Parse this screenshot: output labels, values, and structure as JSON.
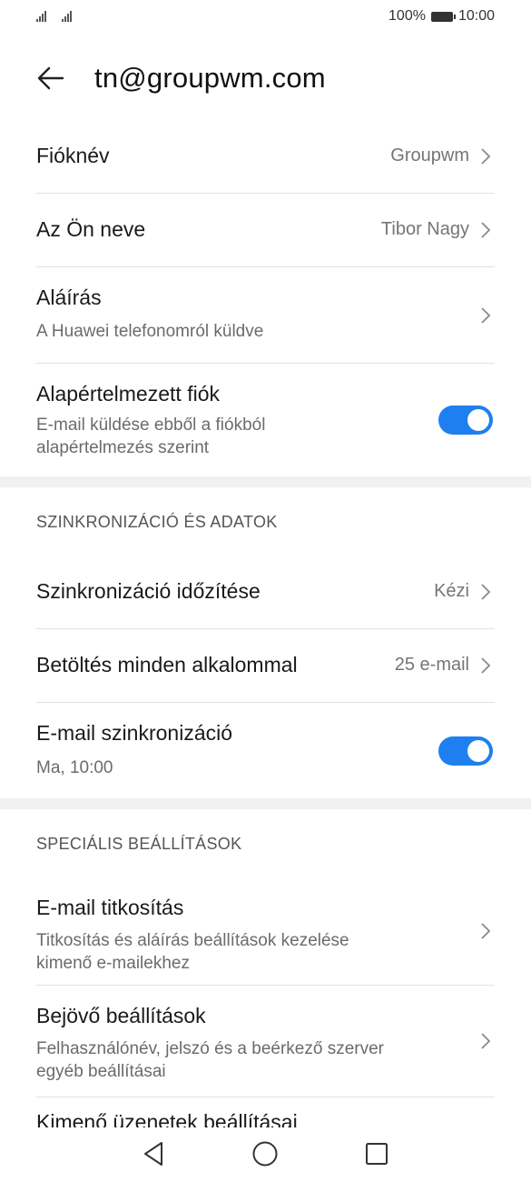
{
  "status_bar": {
    "battery_percent": "100%",
    "time": "10:00"
  },
  "header": {
    "title": "tn@groupwm.com",
    "back_icon": "arrow-left-icon"
  },
  "account": {
    "account_name": {
      "label": "Fióknév",
      "value": "Groupwm"
    },
    "your_name": {
      "label": "Az Ön neve",
      "value": "Tibor Nagy"
    },
    "signature": {
      "label": "Aláírás",
      "subtitle": "A Huawei telefonomról küldve"
    },
    "default_account": {
      "label": "Alapértelmezett fiók",
      "subtitle_line1": "E-mail küldése ebből a fiókból",
      "subtitle_line2": "alapértelmezés szerint",
      "enabled": true
    }
  },
  "sync_section": {
    "header": "SZINKRONIZÁCIÓ ÉS ADATOK",
    "schedule": {
      "label": "Szinkronizáció időzítése",
      "value": "Kézi"
    },
    "load_each_time": {
      "label": "Betöltés minden alkalommal",
      "value": "25 e-mail"
    },
    "email_sync": {
      "label": "E-mail szinkronizáció",
      "subtitle": "Ma, 10:00",
      "enabled": true
    }
  },
  "advanced_section": {
    "header": "SPECIÁLIS BEÁLLÍTÁSOK",
    "encryption": {
      "label": "E-mail titkosítás",
      "subtitle_line1": "Titkosítás és aláírás beállítások kezelése",
      "subtitle_line2": "kimenő e-mailekhez"
    },
    "incoming": {
      "label": "Bejövő beállítások",
      "subtitle_line1": "Felhasználónév, jelszó és a beérkező szerver",
      "subtitle_line2": "egyéb beállításai"
    },
    "outgoing": {
      "label": "Kimenő üzenetek beállításai"
    }
  },
  "colors": {
    "accent": "#1e7ff0",
    "divider": "#e2e2e2",
    "band": "#f1f1f1"
  }
}
